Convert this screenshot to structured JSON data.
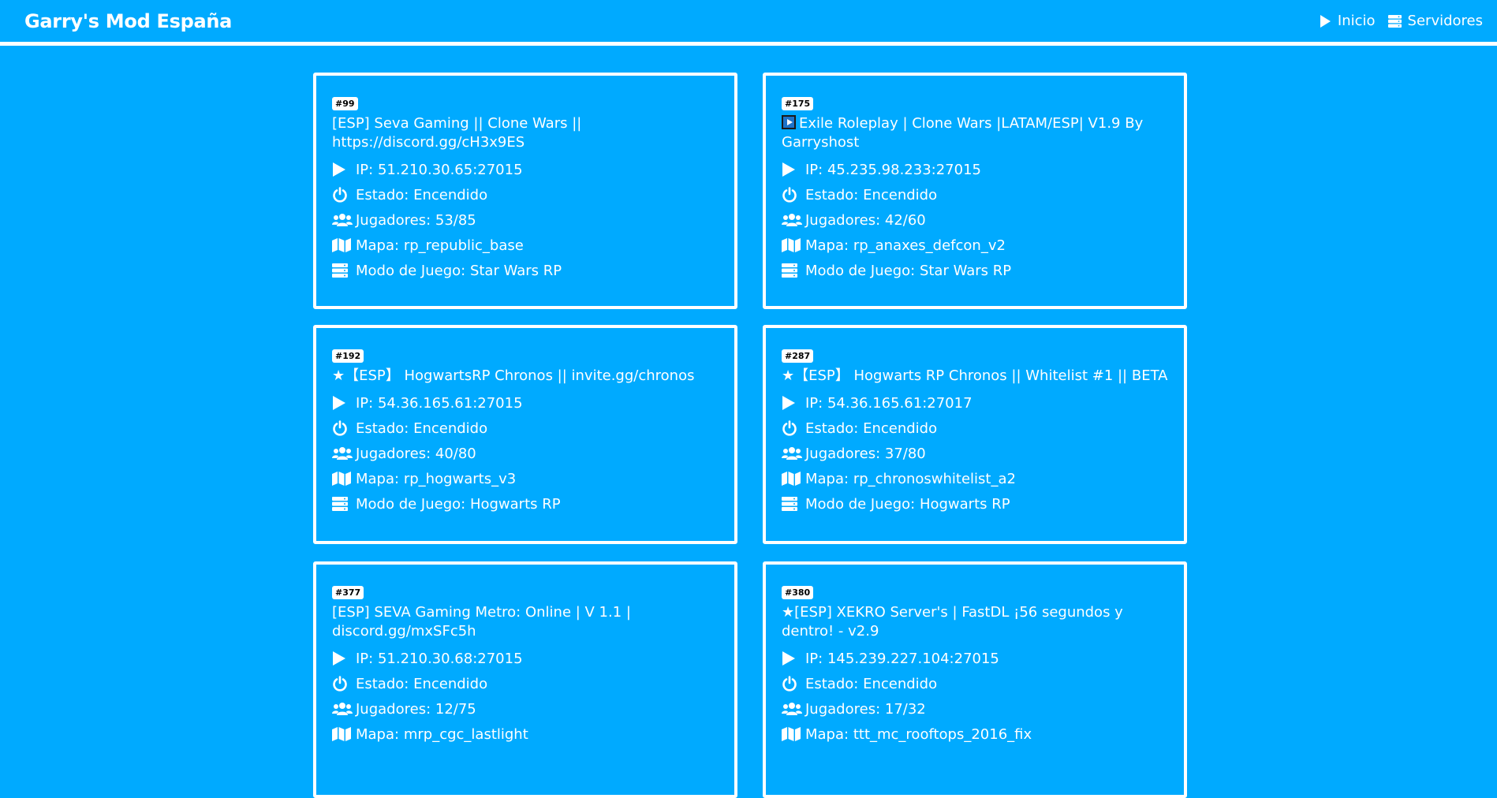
{
  "nav": {
    "brand": "Garry's Mod España",
    "links": [
      {
        "label": "Inicio",
        "icon": "play-icon"
      },
      {
        "label": "Servidores",
        "icon": "server-icon"
      }
    ]
  },
  "labels": {
    "ip": "IP: ",
    "status": "Estado: ",
    "players": "Jugadores: ",
    "map": "Mapa: ",
    "gamemode": "Modo de Juego: "
  },
  "servers": [
    {
      "rank": "#99",
      "name": "[ESP] Seva Gaming || Clone Wars || https://discord.gg/cH3x9ES",
      "has_play_emoji": false,
      "ip": "51.210.30.65:27015",
      "status": "Encendido",
      "players": "53/85",
      "map": "rp_republic_base",
      "gamemode": "Star Wars RP"
    },
    {
      "rank": "#175",
      "name": "Exile Roleplay | Clone Wars |LATAM/ESP| V1.9 By Garryshost",
      "has_play_emoji": true,
      "ip": "45.235.98.233:27015",
      "status": "Encendido",
      "players": "42/60",
      "map": "rp_anaxes_defcon_v2",
      "gamemode": "Star Wars RP"
    },
    {
      "rank": "#192",
      "name": "★【ESP】 HogwartsRP Chronos || invite.gg/chronos",
      "has_play_emoji": false,
      "ip": "54.36.165.61:27015",
      "status": "Encendido",
      "players": "40/80",
      "map": "rp_hogwarts_v3",
      "gamemode": "Hogwarts RP"
    },
    {
      "rank": "#287",
      "name": "★【ESP】 Hogwarts RP Chronos || Whitelist #1 || BETA",
      "has_play_emoji": false,
      "ip": "54.36.165.61:27017",
      "status": "Encendido",
      "players": "37/80",
      "map": "rp_chronoswhitelist_a2",
      "gamemode": "Hogwarts RP"
    },
    {
      "rank": "#377",
      "name": "[ESP] SEVA Gaming Metro: Online | V 1.1 | discord.gg/mxSFc5h",
      "has_play_emoji": false,
      "ip": "51.210.30.68:27015",
      "status": "Encendido",
      "players": "12/75",
      "map": "mrp_cgc_lastlight",
      "gamemode": ""
    },
    {
      "rank": "#380",
      "name": "★[ESP] XEKRO Server's | FastDL ¡56 segundos y dentro! - v2.9",
      "has_play_emoji": false,
      "ip": "145.239.227.104:27015",
      "status": "Encendido",
      "players": "17/32",
      "map": "ttt_mc_rooftops_2016_fix",
      "gamemode": ""
    }
  ],
  "colors": {
    "background": "#00aaff",
    "text": "#ffffff",
    "border": "#ffffff"
  }
}
